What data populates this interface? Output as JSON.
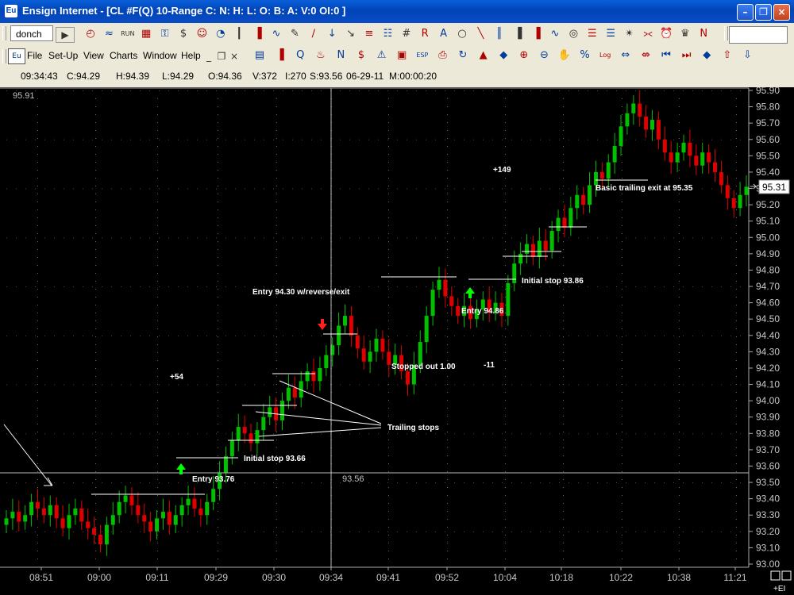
{
  "window": {
    "title": "Ensign Internet - [CL #F(Q) 10-Range C: N: H: L: O: B: A: V:0 OI:0 ]",
    "app_icon": "Eu"
  },
  "toolbar1": {
    "tab_label": "donch",
    "icons": [
      "clock-icon",
      "wave-icon",
      "run-icon",
      "grid-icon",
      "lock-icon",
      "money-bag-icon",
      "face-icon",
      "gauge-icon",
      "bar-icon",
      "candle-icon",
      "line-chart-icon",
      "pen-icon",
      "trend-line-icon",
      "down-arrow-icon",
      "red-arrow-icon",
      "fibonacci-icon",
      "grid-lines-icon",
      "hashtag-icon",
      "box-r-icon",
      "box-a-icon",
      "ellipse-icon",
      "diagonal-icon",
      "channel-icon",
      "bars-icon",
      "bars2-icon",
      "sine-icon",
      "circle-icon",
      "stack-icon",
      "lines-icon",
      "star-icon",
      "fan-icon",
      "alarm-icon",
      "crown-icon",
      "n-icon"
    ],
    "run_label": "RUN",
    "n_label": "N"
  },
  "toolbar2": {
    "menus": [
      "File",
      "Set-Up",
      "View",
      "Charts",
      "Window",
      "Help"
    ],
    "icons": [
      "layout-icon",
      "chart-icon",
      "quote-icon",
      "fire-icon",
      "news-icon",
      "dollar-icon",
      "alert-icon",
      "portfolio-icon",
      "esp-icon",
      "print-icon",
      "refresh-icon",
      "triangle-icon",
      "marker-icon",
      "zoom-in-icon",
      "zoom-out-icon",
      "hand-icon",
      "percent-icon",
      "log-icon",
      "expand-icon",
      "compress-icon",
      "first-icon",
      "last-icon",
      "up-down-icon",
      "up-icon",
      "down-icon"
    ],
    "log_label": "Log",
    "percent_label": "%",
    "esp_label": "ESP"
  },
  "info": {
    "time": "09:34:43",
    "close": "C:94.29",
    "high": "H:94.39",
    "low": "L:94.29",
    "open": "O:94.36",
    "volume": "V:372",
    "interval": "I:270",
    "spread": "S:93.56",
    "date": "06-29-11",
    "minute": "M:00:00:20"
  },
  "chart": {
    "top_left_value": "95.91",
    "crosshair_value": "93.56",
    "current_price": "95.31",
    "corner_label": "+EI",
    "annotations": {
      "plus149": "+149",
      "basic_exit": "Basic trailing exit at 95.35",
      "initial_stop_2": "Initial stop 93.86",
      "entry_reverse": "Entry 94.30 w/reverse/exit",
      "entry_2": "Entry 94.86",
      "plus54": "+54",
      "stopped_out": "Stopped out 1.00",
      "minus11": "-11",
      "trailing_stops": "Trailing stops",
      "initial_stop_1": "Initial stop 93.66",
      "entry_1": "Entry 93.76"
    }
  },
  "chart_data": {
    "type": "candlestick",
    "symbol": "CL #F(Q)",
    "interval": "10-Range",
    "y_ticks": [
      "95.90",
      "95.80",
      "95.70",
      "95.60",
      "95.50",
      "95.40",
      "95.30",
      "95.20",
      "95.10",
      "95.00",
      "94.90",
      "94.80",
      "94.70",
      "94.60",
      "94.50",
      "94.40",
      "94.30",
      "94.20",
      "94.10",
      "94.00",
      "93.90",
      "93.80",
      "93.70",
      "93.60",
      "93.50",
      "93.40",
      "93.30",
      "93.20",
      "93.10",
      "93.00"
    ],
    "ylim": [
      93.0,
      95.91
    ],
    "x_labels": [
      "08:51",
      "09:00",
      "09:11",
      "09:29",
      "09:30",
      "09:34",
      "09:41",
      "09:52",
      "10:04",
      "10:18",
      "10:22",
      "10:38",
      "11:21"
    ],
    "closes": [
      93.28,
      93.32,
      93.26,
      93.3,
      93.38,
      93.34,
      93.3,
      93.36,
      93.28,
      93.22,
      93.3,
      93.34,
      93.26,
      93.22,
      93.18,
      93.12,
      93.24,
      93.3,
      93.38,
      93.42,
      93.36,
      93.3,
      93.26,
      93.2,
      93.28,
      93.32,
      93.24,
      93.3,
      93.36,
      93.4,
      93.34,
      93.3,
      93.38,
      93.46,
      93.56,
      93.66,
      93.76,
      93.84,
      93.8,
      93.74,
      93.82,
      93.9,
      93.96,
      93.88,
      94.0,
      94.08,
      94.02,
      94.12,
      94.18,
      94.12,
      94.2,
      94.28,
      94.34,
      94.46,
      94.52,
      94.4,
      94.32,
      94.24,
      94.3,
      94.38,
      94.3,
      94.22,
      94.28,
      94.18,
      94.1,
      94.22,
      94.36,
      94.52,
      94.68,
      94.74,
      94.64,
      94.58,
      94.52,
      94.58,
      94.5,
      94.56,
      94.62,
      94.54,
      94.6,
      94.52,
      94.72,
      94.84,
      94.9,
      94.96,
      94.88,
      94.98,
      94.92,
      95.04,
      95.12,
      95.06,
      95.18,
      95.26,
      95.2,
      95.32,
      95.4,
      95.36,
      95.46,
      95.56,
      95.68,
      95.76,
      95.82,
      95.74,
      95.66,
      95.72,
      95.6,
      95.52,
      95.46,
      95.52,
      95.58,
      95.5,
      95.44,
      95.52,
      95.46,
      95.4,
      95.32,
      95.24,
      95.18,
      95.26,
      95.31
    ],
    "trade_levels": {
      "entry_1": 93.76,
      "initial_stop_1": 93.66,
      "entry_2": 94.86,
      "initial_stop_2": 93.86,
      "exit_reverse": 94.3,
      "basic_trailing_exit": 95.35,
      "stopped_out": 1.0
    }
  },
  "colors": {
    "up_candle": "#00c000",
    "down_candle": "#e00000",
    "background": "#000000",
    "annotation": "#ffffff",
    "arrow_up": "#00ff00",
    "arrow_down": "#ff2020",
    "axis_text": "#c0c0c0"
  }
}
